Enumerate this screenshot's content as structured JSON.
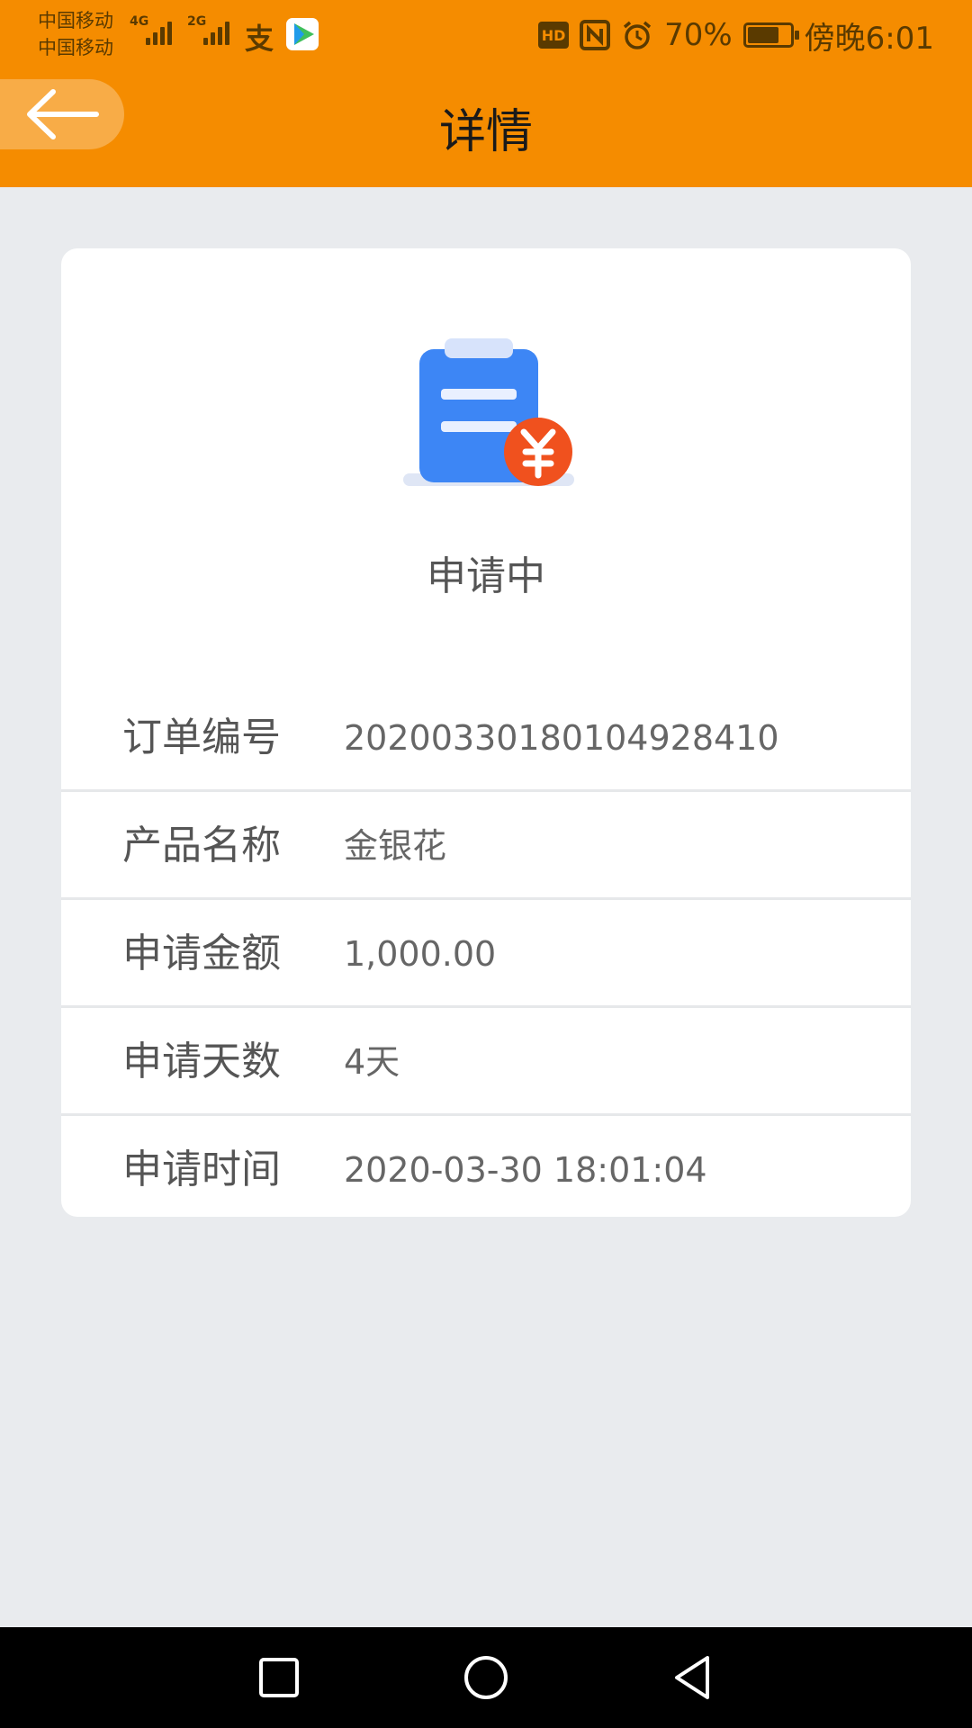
{
  "status_bar": {
    "carrier_1": "中国移动",
    "carrier_2": "中国移动",
    "network_1": "4G",
    "network_2": "2G",
    "alipay_glyph": "支",
    "hd_badge": "HD",
    "battery_percent": "70%",
    "time": "傍晚6:01",
    "battery_level": 0.7
  },
  "header": {
    "title": "详情",
    "back_icon": "arrow-left-icon"
  },
  "status": {
    "icon": "clipboard-yuan-icon",
    "text": "申请中"
  },
  "details": [
    {
      "label": "订单编号",
      "value": "20200330180104928410"
    },
    {
      "label": "产品名称",
      "value": "金银花"
    },
    {
      "label": "申请金额",
      "value": "1,000.00"
    },
    {
      "label": "申请天数",
      "value": "4天"
    },
    {
      "label": "申请时间",
      "value": "2020-03-30 18:01:04"
    }
  ],
  "nav": {
    "recents_icon": "square-icon",
    "home_icon": "circle-icon",
    "back_icon": "triangle-back-icon"
  },
  "colors": {
    "header_bg": "#f58c00",
    "page_bg": "#e9ebee",
    "card_bg": "#ffffff",
    "icon_blue": "#3d86f5",
    "badge_orange": "#f0511e"
  }
}
